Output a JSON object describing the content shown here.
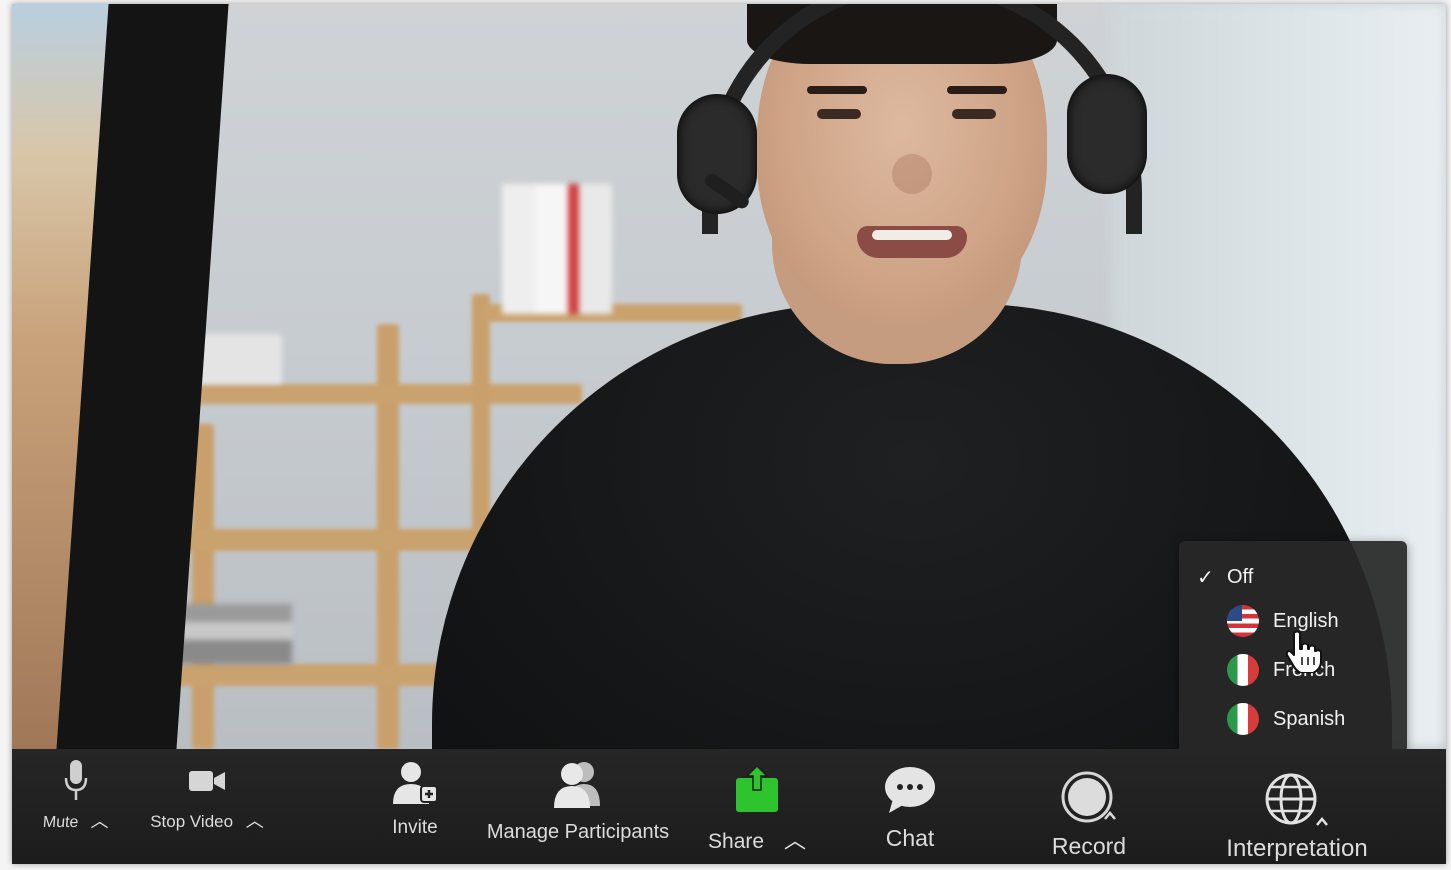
{
  "interpretation_menu": {
    "items": [
      {
        "label": "Off",
        "checked": true,
        "flag": null,
        "check_mark": "✓"
      },
      {
        "label": "English",
        "checked": false,
        "flag": "us-flag"
      },
      {
        "label": "French",
        "checked": false,
        "flag": "it-flag"
      },
      {
        "label": "Spanish",
        "checked": false,
        "flag": "it-flag"
      }
    ]
  },
  "toolbar": {
    "mute_label": "Mute",
    "stop_video_label": "Stop Video",
    "invite_label": "Invite",
    "manage_participants_label": "Manage Participants",
    "share_label": "Share",
    "chat_label": "Chat",
    "record_label": "Record",
    "interpretation_label": "Interpretation",
    "caret": "^"
  },
  "colors": {
    "share_green": "#2dc42d",
    "toolbar_bg": "#222222",
    "menu_bg": "#282828",
    "text": "#dcdcdc"
  }
}
